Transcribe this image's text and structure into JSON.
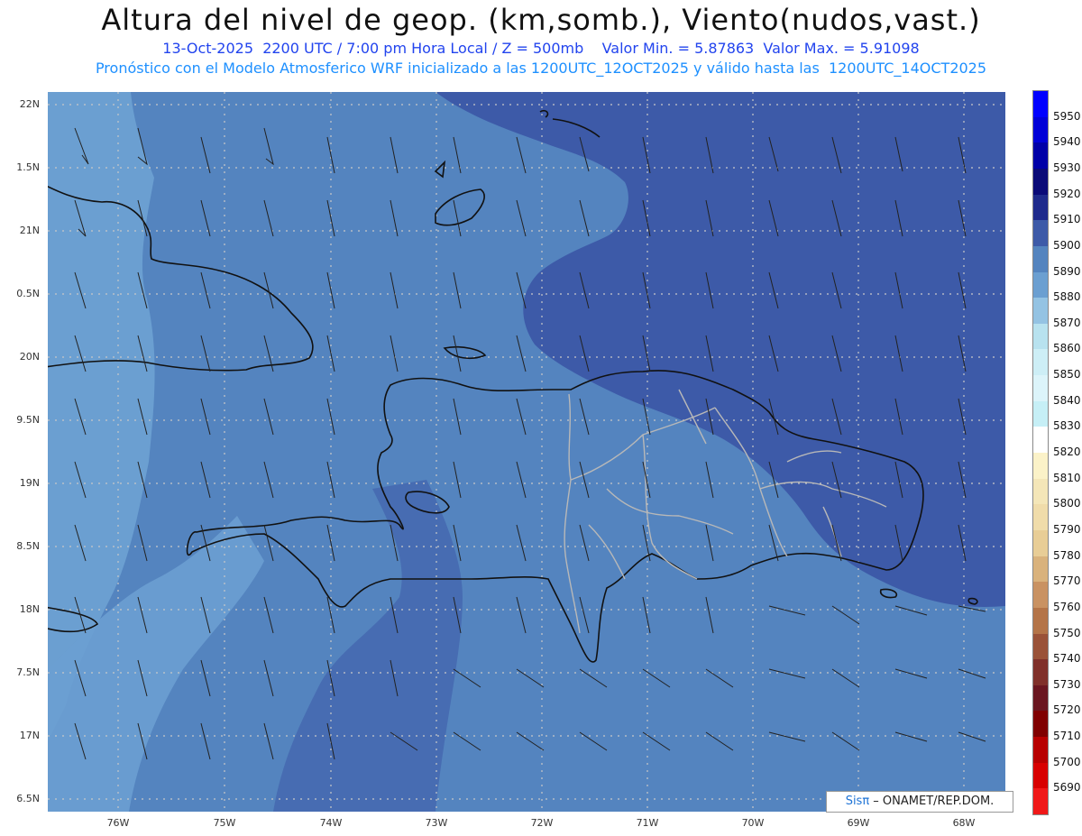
{
  "header": {
    "title": "Altura del nivel de geop. (km,somb.), Viento(nudos,vast.)",
    "line1": "13-Oct-2025  2200 UTC / 7:00 pm Hora Local / Z = 500mb    Valor Min. = 5.87863  Valor Max. = 5.91098",
    "line2": "Pronóstico con el Modelo Atmosferico WRF inicializado a las 1200UTC_12OCT2025 y válido hasta las  1200UTC_14OCT2025"
  },
  "map": {
    "lat_labels": [
      "22N",
      "1.5N",
      "21N",
      "0.5N",
      "20N",
      "9.5N",
      "19N",
      "8.5N",
      "18N",
      "7.5N",
      "17N",
      "6.5N"
    ],
    "lon_labels": [
      "76W",
      "75W",
      "74W",
      "73W",
      "72W",
      "71W",
      "70W",
      "69W",
      "68W"
    ],
    "colors": {
      "shade_5880": "#6b9fd1",
      "shade_5890": "#5484bf",
      "shade_5900": "#3d5aa8",
      "coast": "#111111",
      "province_border": "#b8b8b8",
      "grid": "#c8c8c8",
      "barb": "#222222"
    }
  },
  "colorbar": {
    "labels": [
      "5950",
      "5940",
      "5930",
      "5920",
      "5910",
      "5900",
      "5890",
      "5880",
      "5870",
      "5860",
      "5850",
      "5840",
      "5830",
      "5820",
      "5810",
      "5800",
      "5790",
      "5780",
      "5770",
      "5760",
      "5750",
      "5740",
      "5730",
      "5720",
      "5710",
      "5700",
      "5690"
    ],
    "colors": [
      "#0000ff",
      "#0000d8",
      "#0000a8",
      "#0a0a78",
      "#1e2a8c",
      "#3d5aa8",
      "#5484bf",
      "#6b9fd1",
      "#94c3e3",
      "#b8e2ef",
      "#cdeef6",
      "#dcf4fa",
      "#c6eff6",
      "#ffffff",
      "#fbf2c8",
      "#f4e6b8",
      "#f0dcaa",
      "#e8cd96",
      "#d9b27c",
      "#c99262",
      "#b47448",
      "#9a5238",
      "#80302a",
      "#6a1620",
      "#800000",
      "#b80000",
      "#d80000",
      "#f01818"
    ]
  },
  "footer": {
    "logo_brand": "Sisπ",
    "logo_text": " – ONAMET/REP.DOM."
  }
}
